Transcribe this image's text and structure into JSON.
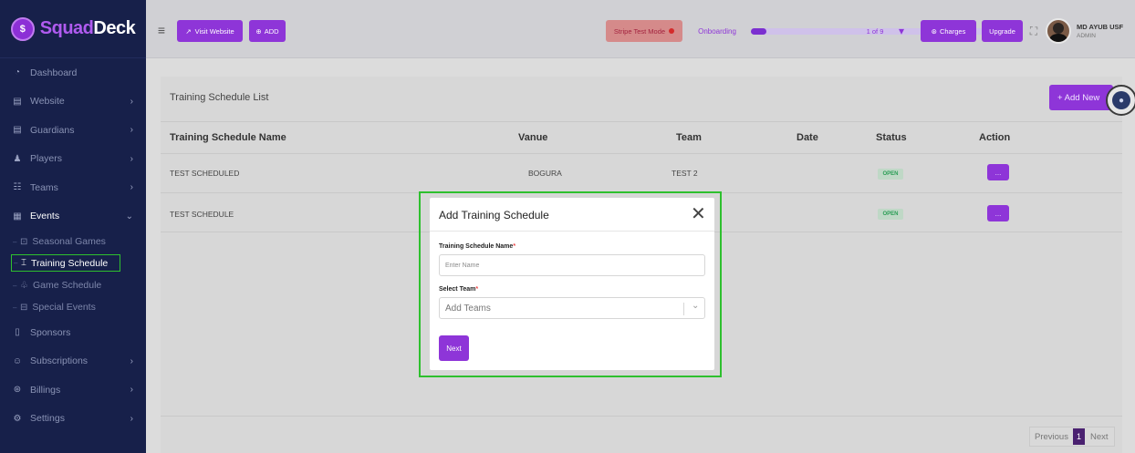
{
  "brand": {
    "name_part1": "Squad",
    "name_part2": "Deck"
  },
  "sidebar": {
    "items": [
      {
        "label": "Dashboard",
        "icon": "dashboard-icon"
      },
      {
        "label": "Website",
        "icon": "website-icon"
      },
      {
        "label": "Guardians",
        "icon": "guardians-icon"
      },
      {
        "label": "Players",
        "icon": "players-icon"
      },
      {
        "label": "Teams",
        "icon": "teams-icon"
      },
      {
        "label": "Events",
        "icon": "calendar-icon"
      },
      {
        "label": "Sponsors",
        "icon": "sponsors-icon"
      },
      {
        "label": "Subscriptions",
        "icon": "subscriptions-icon"
      },
      {
        "label": "Billings",
        "icon": "billings-icon"
      },
      {
        "label": "Settings",
        "icon": "gear-icon"
      }
    ],
    "events_sub": [
      {
        "label": "Seasonal Games"
      },
      {
        "label": "Training Schedule"
      },
      {
        "label": "Game Schedule"
      },
      {
        "label": "Special Events"
      }
    ]
  },
  "topbar": {
    "visit_website": "Visit Website",
    "add": "ADD",
    "stripe_mode": "Stripe Test Mode",
    "onboarding": "Onboarding",
    "onboarding_progress": 0.06,
    "step": "1 of 9",
    "charges": "Charges",
    "upgrade": "Upgrade",
    "user_name": "MD AYUB USF",
    "user_role": "ADMIN"
  },
  "page": {
    "title": "Training Schedule List",
    "add_new": "+ Add New",
    "columns": [
      "Training Schedule Name",
      "Vanue",
      "Team",
      "Date",
      "Status",
      "Action"
    ],
    "rows": [
      {
        "name": "TEST SCHEDULED",
        "venue": "BOGURA",
        "team": "TEST 2",
        "date": "",
        "status": "OPEN",
        "action": "..."
      },
      {
        "name": "TEST SCHEDULE",
        "venue": "",
        "team": "",
        "date": "",
        "status": "OPEN",
        "action": "..."
      }
    ],
    "pagination": {
      "previous": "Previous",
      "current": "1",
      "next": "Next"
    }
  },
  "modal": {
    "title": "Add Training Schedule",
    "close": "✕",
    "name_label": "Training Schedule Name",
    "name_placeholder": "Enter Name",
    "team_label": "Select Team",
    "team_placeholder": "Add Teams",
    "required_mark": "*",
    "next": "Next"
  },
  "colors": {
    "accent": "#8e35d8",
    "sidebar_bg": "#17204a",
    "highlight": "#2ec02e"
  }
}
